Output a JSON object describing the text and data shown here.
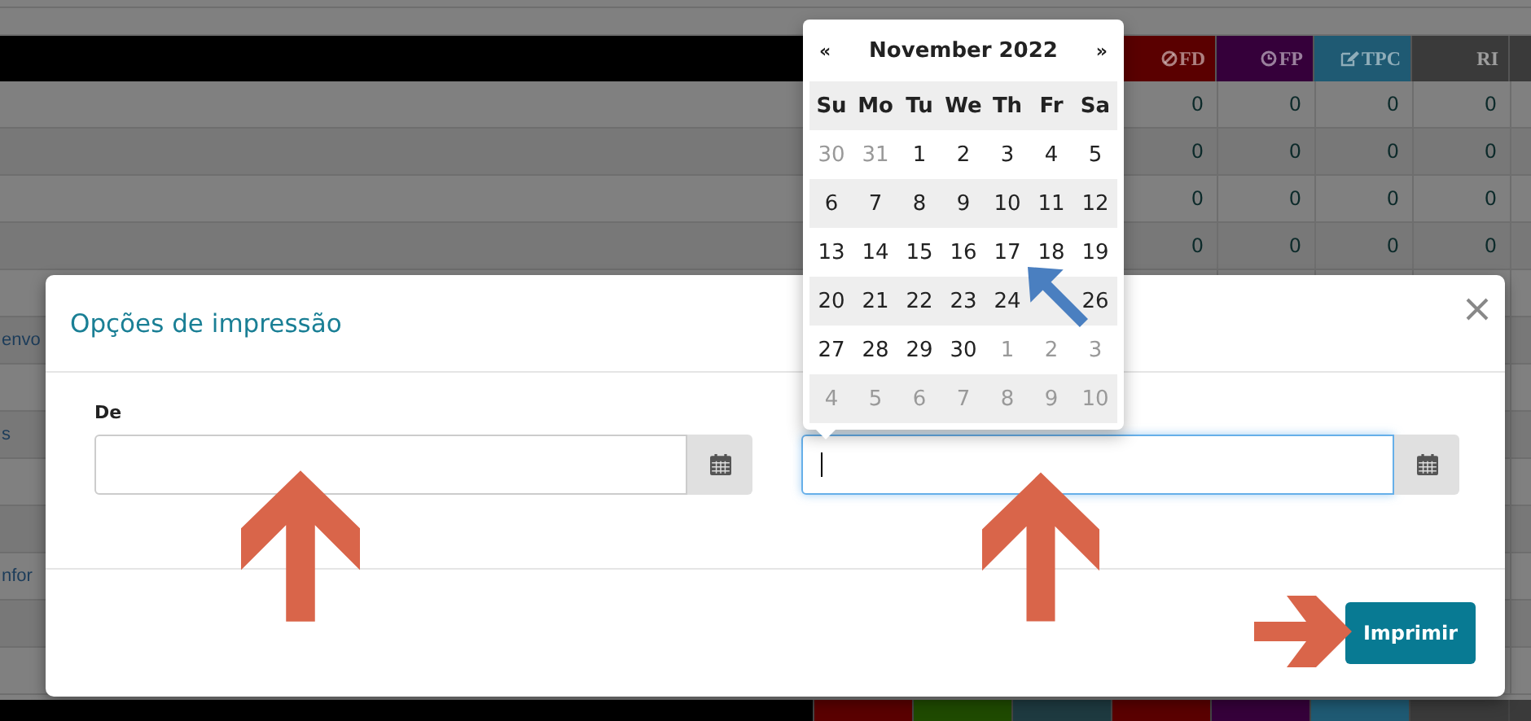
{
  "background_table": {
    "header": [
      {
        "label": "FD",
        "kind": "ban",
        "color": "#5a0000"
      },
      {
        "label": "FP",
        "kind": "clock",
        "color": "#35003a"
      },
      {
        "label": "TPC",
        "kind": "edit",
        "color": "#1f5a73"
      },
      {
        "label": "RI",
        "kind": "none",
        "color": "#3a3a3a"
      }
    ],
    "rows": [
      {
        "values": [
          "0",
          "0",
          "0",
          "0"
        ]
      },
      {
        "values": [
          "0",
          "0",
          "0",
          "0"
        ]
      },
      {
        "values": [
          "0",
          "0",
          "0",
          "0"
        ]
      },
      {
        "values": [
          "0",
          "0",
          "0",
          "0"
        ]
      },
      {},
      {
        "label": "envo"
      },
      {},
      {
        "label": "s"
      },
      {},
      {},
      {
        "label": "nfor"
      },
      {},
      {}
    ],
    "footer_header": [
      {
        "color": "#5a0000"
      },
      {
        "color": "#1f4a00"
      },
      {
        "color": "#1e3a40"
      },
      {
        "color": "#5a0000"
      },
      {
        "color": "#35003a"
      },
      {
        "color": "#1f5a73"
      },
      {
        "color": "#3a3a3a"
      }
    ]
  },
  "dialog": {
    "title": "Opções de impressão",
    "fields": [
      {
        "label": "De",
        "focused": false
      },
      {
        "focused": true
      }
    ],
    "button": "Imprimir"
  },
  "datepicker": {
    "prev": "«",
    "title": "November 2022",
    "next": "»",
    "weekdays": [
      "Su",
      "Mo",
      "Tu",
      "We",
      "Th",
      "Fr",
      "Sa"
    ],
    "weeks": [
      {
        "shaded": false,
        "days": [
          {
            "day": "30",
            "muted": true
          },
          {
            "day": "31",
            "muted": true
          },
          {
            "day": "1",
            "muted": false
          },
          {
            "day": "2",
            "muted": false
          },
          {
            "day": "3",
            "muted": false
          },
          {
            "day": "4",
            "muted": false
          },
          {
            "day": "5",
            "muted": false
          }
        ]
      },
      {
        "shaded": true,
        "days": [
          {
            "day": "6",
            "muted": false
          },
          {
            "day": "7",
            "muted": false
          },
          {
            "day": "8",
            "muted": false
          },
          {
            "day": "9",
            "muted": false
          },
          {
            "day": "10",
            "muted": false
          },
          {
            "day": "11",
            "muted": false
          },
          {
            "day": "12",
            "muted": false
          }
        ]
      },
      {
        "shaded": false,
        "days": [
          {
            "day": "13",
            "muted": false
          },
          {
            "day": "14",
            "muted": false
          },
          {
            "day": "15",
            "muted": false
          },
          {
            "day": "16",
            "muted": false
          },
          {
            "day": "17",
            "muted": false
          },
          {
            "day": "18",
            "muted": false
          },
          {
            "day": "19",
            "muted": false
          }
        ]
      },
      {
        "shaded": true,
        "days": [
          {
            "day": "20",
            "muted": false
          },
          {
            "day": "21",
            "muted": false
          },
          {
            "day": "22",
            "muted": false
          },
          {
            "day": "23",
            "muted": false
          },
          {
            "day": "24",
            "muted": false
          },
          {
            "kind": "arrow"
          },
          {
            "day": "26",
            "muted": false
          }
        ]
      },
      {
        "shaded": false,
        "days": [
          {
            "day": "27",
            "muted": false
          },
          {
            "day": "28",
            "muted": false
          },
          {
            "day": "29",
            "muted": false
          },
          {
            "day": "30",
            "muted": false
          },
          {
            "day": "1",
            "muted": true
          },
          {
            "day": "2",
            "muted": true
          },
          {
            "day": "3",
            "muted": true
          }
        ]
      },
      {
        "shaded": true,
        "days": [
          {
            "day": "4",
            "muted": true
          },
          {
            "day": "5",
            "muted": true
          },
          {
            "day": "6",
            "muted": true
          },
          {
            "day": "7",
            "muted": true
          },
          {
            "day": "8",
            "muted": true
          },
          {
            "day": "9",
            "muted": true
          },
          {
            "day": "10",
            "muted": true
          }
        ]
      }
    ]
  }
}
